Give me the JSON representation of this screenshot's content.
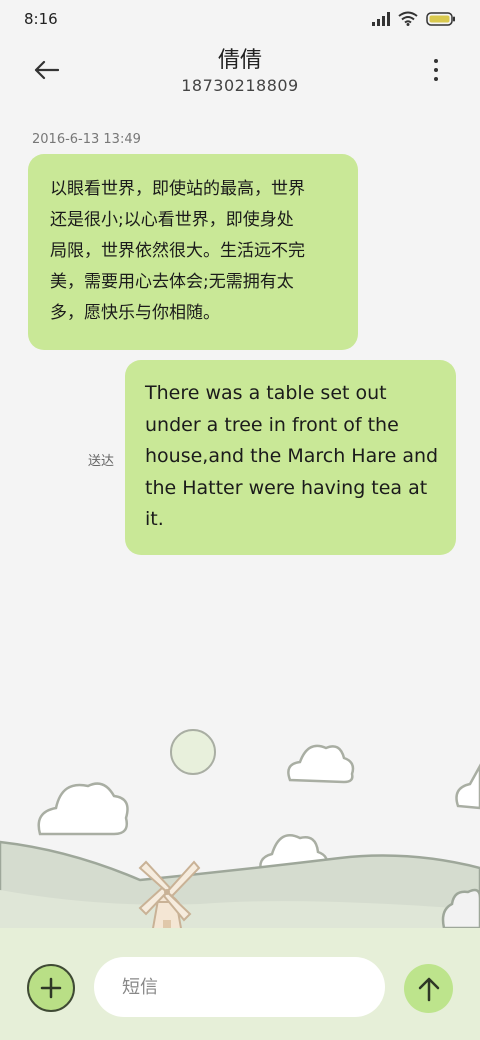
{
  "status": {
    "time": "8:16",
    "icons": [
      "signal-icon",
      "wifi-icon",
      "battery-icon"
    ]
  },
  "header": {
    "title": "倩倩",
    "phone": "18730218809",
    "back_icon": "back-arrow-icon",
    "more_icon": "more-vertical-icon"
  },
  "conversation": {
    "timestamp": "2016-6-13 13:49",
    "messages": [
      {
        "direction": "incoming",
        "lines": [
          "以眼看世界，即使站的最高，世界",
          "还是很小;以心看世界，即使身处",
          "局限，世界依然很大。生活远不完",
          "美，需要用心去体会;无需拥有太",
          "多，愿快乐与你相随。"
        ]
      },
      {
        "direction": "outgoing",
        "lines": [
          "There was a table set out",
          "under a tree in front of the",
          "house,and the March Hare and",
          "the Hatter were having tea at",
          "it."
        ],
        "status": "送达"
      }
    ]
  },
  "composer": {
    "placeholder": "短信",
    "value": "",
    "add_icon": "plus-icon",
    "send_icon": "up-arrow-icon"
  },
  "colors": {
    "bubble": "#c9e897",
    "background": "#f4f4f4",
    "composer_bar": "#e6efd8",
    "accent": "#bde48c"
  }
}
